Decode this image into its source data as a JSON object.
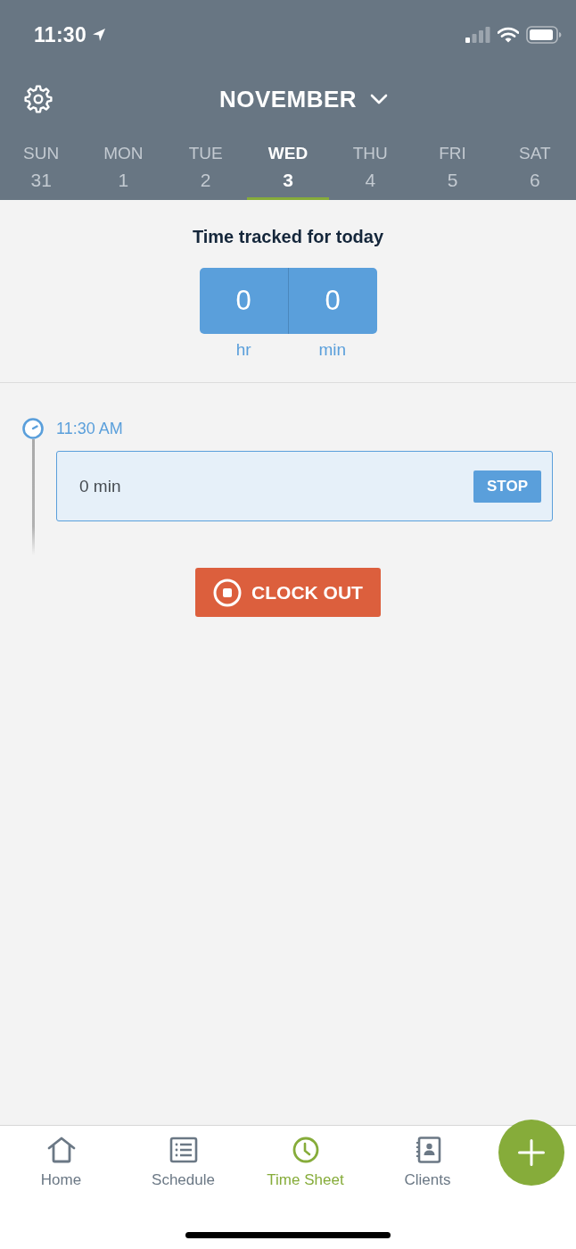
{
  "status_bar": {
    "time": "11:30"
  },
  "header": {
    "month": "NOVEMBER"
  },
  "days": [
    {
      "name": "SUN",
      "date": "31",
      "selected": false
    },
    {
      "name": "MON",
      "date": "1",
      "selected": false
    },
    {
      "name": "TUE",
      "date": "2",
      "selected": false
    },
    {
      "name": "WED",
      "date": "3",
      "selected": true
    },
    {
      "name": "THU",
      "date": "4",
      "selected": false
    },
    {
      "name": "FRI",
      "date": "5",
      "selected": false
    },
    {
      "name": "SAT",
      "date": "6",
      "selected": false
    }
  ],
  "tracked": {
    "title": "Time tracked for today",
    "units": [
      {
        "value": "0",
        "label": "hr"
      },
      {
        "value": "0",
        "label": "min"
      }
    ]
  },
  "entries": [
    {
      "time": "11:30 AM",
      "duration": "0 min",
      "action": "STOP"
    }
  ],
  "clock_out": {
    "label": "CLOCK OUT"
  },
  "nav": [
    {
      "label": "Home",
      "selected": false
    },
    {
      "label": "Schedule",
      "selected": false
    },
    {
      "label": "Time Sheet",
      "selected": true
    },
    {
      "label": "Clients",
      "selected": false
    }
  ]
}
